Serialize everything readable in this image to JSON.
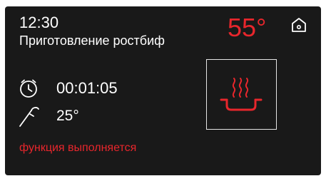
{
  "status_bar": {
    "time": "12:30",
    "temperature": "55°"
  },
  "program": {
    "title": "Приготовление ростбиф"
  },
  "timer": {
    "icon": "stopwatch-icon",
    "value": "00:01:05"
  },
  "probe": {
    "icon": "meat-probe-icon",
    "value": "25°"
  },
  "status": {
    "message": "функция выполняется"
  },
  "mode": {
    "icon": "steam-icon"
  },
  "navigation": {
    "icon": "home-icon"
  },
  "colors": {
    "background": "#191919",
    "text": "#ffffff",
    "accent": "#e8262c",
    "frame": "#e6e6e6"
  }
}
